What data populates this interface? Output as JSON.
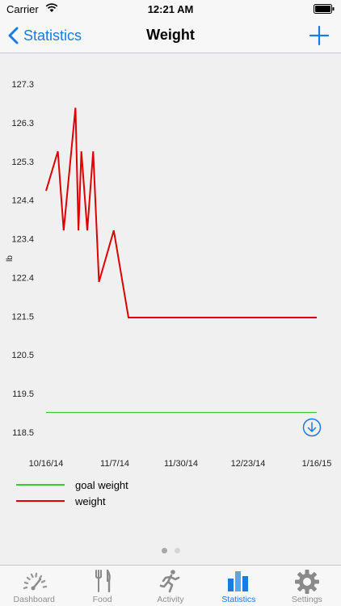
{
  "status_bar": {
    "carrier": "Carrier",
    "time": "12:21 AM"
  },
  "nav": {
    "back_label": "Statistics",
    "title": "Weight"
  },
  "chart_data": {
    "type": "line",
    "ylabel": "lb",
    "ylim": [
      118.5,
      127.3
    ],
    "yticks": [
      "127.3",
      "126.3",
      "125.3",
      "124.4",
      "123.4",
      "122.4",
      "121.5",
      "120.5",
      "119.5",
      "118.5"
    ],
    "xticks": [
      "10/16/14",
      "11/7/14",
      "11/30/14",
      "12/23/14",
      "1/16/15"
    ],
    "series": [
      {
        "name": "weight",
        "color": "#e00000",
        "x": [
          "2014-10-16",
          "2014-10-20",
          "2014-10-22",
          "2014-10-26",
          "2014-10-27",
          "2014-10-28",
          "2014-10-30",
          "2014-11-01",
          "2014-11-03",
          "2014-11-08",
          "2014-11-13",
          "2015-01-16"
        ],
        "values": [
          124.6,
          125.6,
          123.6,
          126.7,
          123.6,
          125.6,
          123.6,
          125.6,
          122.3,
          123.6,
          121.4,
          121.4
        ]
      },
      {
        "name": "goal weight",
        "color": "#33cc33",
        "x": [
          "2014-10-16",
          "2015-01-16"
        ],
        "values": [
          119.0,
          119.0
        ]
      }
    ]
  },
  "legend": {
    "goal_label": "goal weight",
    "weight_label": "weight"
  },
  "tabs": [
    {
      "label": "Dashboard",
      "icon": "gauge-icon",
      "active": false
    },
    {
      "label": "Food",
      "icon": "fork-knife-icon",
      "active": false
    },
    {
      "label": "Activity",
      "icon": "runner-icon",
      "active": false
    },
    {
      "label": "Statistics",
      "icon": "bar-chart-icon",
      "active": true
    },
    {
      "label": "Settings",
      "icon": "gear-icon",
      "active": false
    }
  ],
  "colors": {
    "accent": "#1a7be0",
    "weight_line": "#e00000",
    "goal_line": "#33cc33"
  }
}
